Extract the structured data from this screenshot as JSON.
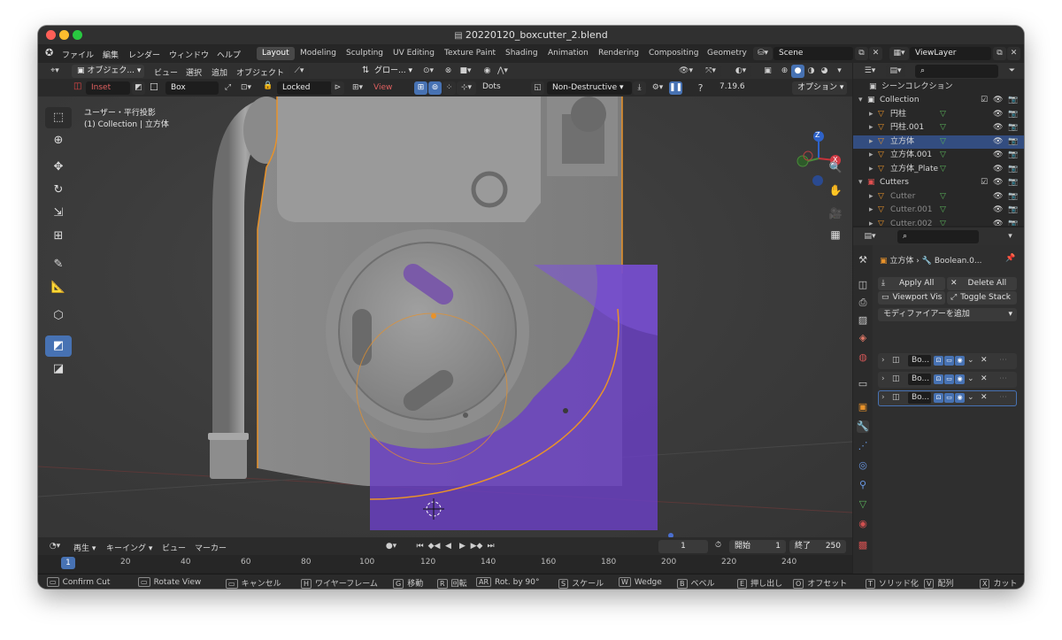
{
  "window": {
    "title": "20220120_boxcutter_2.blend"
  },
  "menubar": {
    "items": [
      "ファイル",
      "編集",
      "レンダー",
      "ウィンドウ",
      "ヘルプ"
    ],
    "workspaces": [
      "Layout",
      "Modeling",
      "Sculpting",
      "UV Editing",
      "Texture Paint",
      "Shading",
      "Animation",
      "Rendering",
      "Compositing",
      "Geometry"
    ],
    "active_workspace": "Layout",
    "scene": "Scene",
    "view_layer": "ViewLayer"
  },
  "viewport_header": {
    "mode": "オブジェク...",
    "menus": [
      "ビュー",
      "選択",
      "追加",
      "オブジェクト"
    ],
    "orientation": "グロー..."
  },
  "tool_header": {
    "operation": "Inset",
    "shape": "Box",
    "lock": "Locked",
    "view": "View",
    "dots": "Dots",
    "mode": "Non-Destructive",
    "version": "7.19.6",
    "options": "オプション"
  },
  "viewport": {
    "projection": "ユーザー・平行投影",
    "collection_info": "(1) Collection | 立方体",
    "gizmo": {
      "x": "X",
      "z": "Z"
    }
  },
  "timeline": {
    "menus": [
      "再生",
      "キーイング",
      "ビュー",
      "マーカー"
    ],
    "current_frame": "1",
    "start_label": "開始",
    "start": "1",
    "end_label": "終了",
    "end": "250",
    "ticks": [
      "1",
      "20",
      "40",
      "60",
      "80",
      "100",
      "120",
      "140",
      "160",
      "180",
      "200",
      "220",
      "240"
    ]
  },
  "statusbar": {
    "items": [
      {
        "key": "",
        "label": "Confirm Cut"
      },
      {
        "key": "",
        "label": "Rotate View"
      },
      {
        "key": "",
        "label": "キャンセル"
      },
      {
        "key": "H",
        "label": "ワイヤーフレーム"
      },
      {
        "key": "G",
        "label": "移動"
      },
      {
        "key": "R",
        "label": "回転"
      },
      {
        "key": "AR",
        "label": "Rot. by 90°"
      },
      {
        "key": "S",
        "label": "スケール"
      },
      {
        "key": "W",
        "label": "Wedge"
      },
      {
        "key": "B",
        "label": "ベベル"
      },
      {
        "key": "E",
        "label": "押し出し"
      },
      {
        "key": "O",
        "label": "オフセット"
      },
      {
        "key": "T",
        "label": "ソリッド化"
      },
      {
        "key": "V",
        "label": "配列"
      },
      {
        "key": "X",
        "label": "カット"
      }
    ]
  },
  "outliner": {
    "root": "シーンコレクション",
    "rows": [
      {
        "label": "Collection",
        "type": "collection",
        "selected": false
      },
      {
        "label": "円柱",
        "type": "object",
        "selected": false
      },
      {
        "label": "円柱.001",
        "type": "object",
        "selected": false
      },
      {
        "label": "立方体",
        "type": "object",
        "selected": true
      },
      {
        "label": "立方体.001",
        "type": "object",
        "selected": false
      },
      {
        "label": "立方体_Plate",
        "type": "object",
        "selected": false
      },
      {
        "label": "Cutters",
        "type": "collection",
        "selected": false
      },
      {
        "label": "Cutter",
        "type": "object",
        "selected": false
      },
      {
        "label": "Cutter.001",
        "type": "object",
        "selected": false
      },
      {
        "label": "Cutter.002",
        "type": "object",
        "selected": false
      }
    ]
  },
  "properties": {
    "object": "立方体",
    "modifier": "Boolean.0...",
    "buttons": {
      "apply_all": "Apply All",
      "delete_all": "Delete All",
      "viewport_vis": "Viewport Vis",
      "toggle_stack": "Toggle Stack"
    },
    "add_modifier": "モディファイアーを追加",
    "modifiers": [
      "Bo...",
      "Bo...",
      "Bo..."
    ]
  },
  "colors": {
    "accent": "#4772b3",
    "selection_outline": "#e8922a",
    "cutter": "#6a3fc4"
  }
}
